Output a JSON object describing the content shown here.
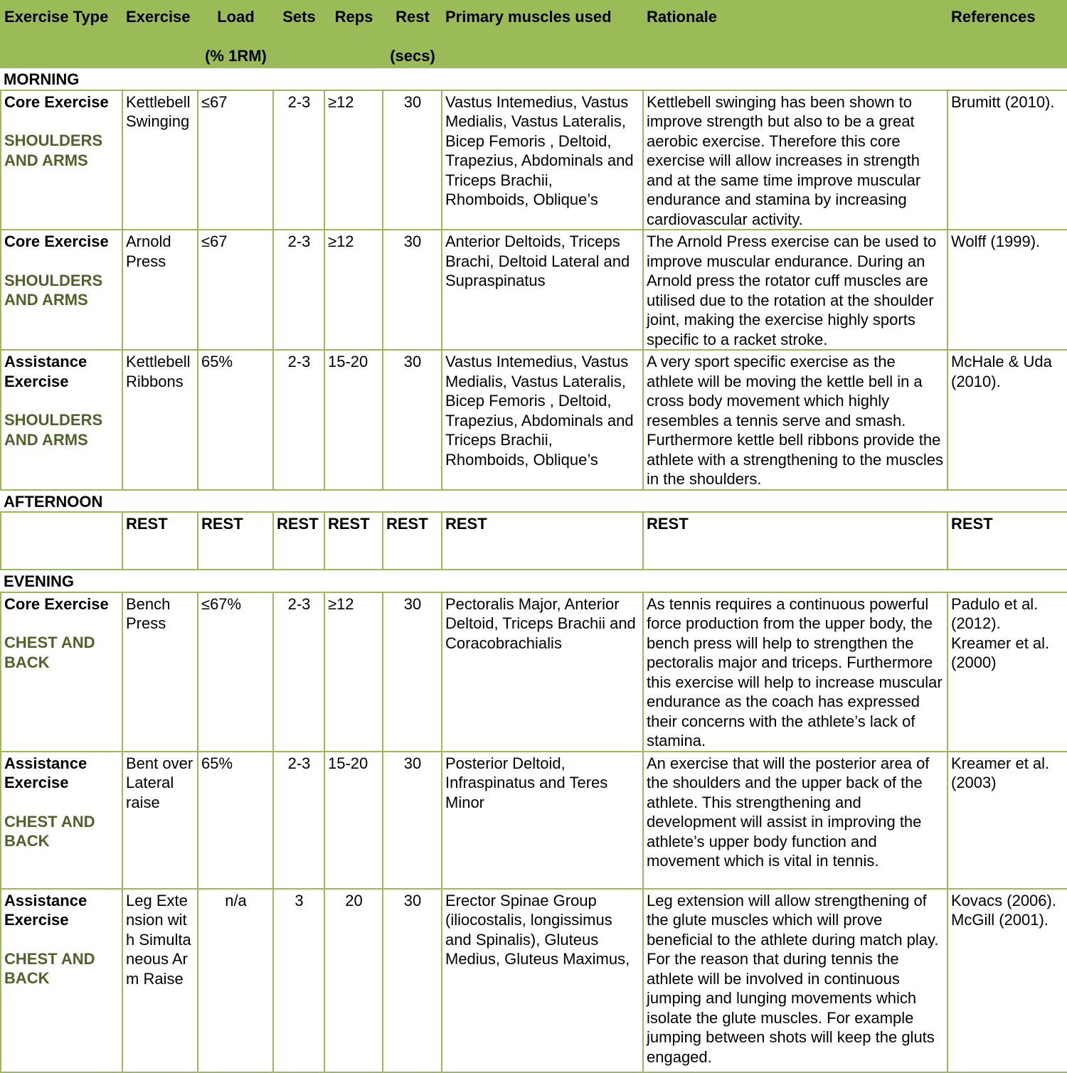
{
  "headers": {
    "exercise_type": "Exercise Type",
    "exercise": "Exercise",
    "load_line1": "Load",
    "load_line2": "(% 1RM)",
    "sets": "Sets",
    "reps": "Reps",
    "rest_line1": "Rest",
    "rest_line2": "(secs)",
    "muscles": "Primary muscles used",
    "rationale": "Rationale",
    "references": "References"
  },
  "morning": {
    "label": "MORNING",
    "rows": [
      {
        "type": "Core Exercise",
        "category": "SHOULDERS AND ARMS",
        "exercise": "Kettlebell Swinging",
        "load": "≤67",
        "sets": "2-3",
        "reps": "≥12",
        "rest": "30",
        "muscles": "Vastus Intemedius, Vastus Medialis, Vastus Lateralis, Bicep Femoris , Deltoid, Trapezius, Abdominals and Triceps Brachii, Rhomboids, Oblique’s",
        "rationale": "Kettlebell swinging has been shown to improve strength but also to be a great aerobic exercise. Therefore this core exercise will allow increases in strength and at the same time improve muscular endurance and stamina by increasing cardiovascular activity.",
        "references": "Brumitt (2010)."
      },
      {
        "type": "Core Exercise",
        "category": "SHOULDERS AND ARMS",
        "exercise": "Arnold Press",
        "load": "≤67",
        "sets": "2-3",
        "reps": "≥12",
        "rest": "30",
        "muscles": "Anterior Deltoids, Triceps Brachi, Deltoid Lateral and Supraspinatus",
        "rationale": "The Arnold Press exercise can be used to improve muscular endurance. During an Arnold press the rotator cuff muscles are utilised due to the rotation at the shoulder joint, making the exercise highly sports specific to a racket stroke.",
        "references": "Wolff (1999)."
      },
      {
        "type": "Assistance Exercise",
        "category": "SHOULDERS AND ARMS",
        "exercise": "Kettlebell Ribbons",
        "load": "65%",
        "sets": "2-3",
        "reps": "15-20",
        "rest": "30",
        "muscles": "Vastus Intemedius, Vastus Medialis, Vastus Lateralis, Bicep Femoris , Deltoid, Trapezius, Abdominals and Triceps Brachii, Rhomboids, Oblique’s",
        "rationale": "A very sport specific exercise as the athlete will be moving the kettle bell in a cross body movement which highly resembles a tennis serve and smash. Furthermore kettle bell ribbons provide the athlete with a strengthening to the muscles in the shoulders.",
        "references": "McHale & Uda (2010)."
      }
    ]
  },
  "afternoon": {
    "label": "AFTERNOON",
    "rest": "REST"
  },
  "evening": {
    "label": "EVENING",
    "rows": [
      {
        "type": "Core Exercise",
        "category": "CHEST AND BACK",
        "exercise": "Bench Press",
        "load": "≤67%",
        "sets": "2-3",
        "reps": "≥12",
        "rest": "30",
        "muscles": "Pectoralis Major, Anterior Deltoid, Triceps Brachii and Coracobrachialis",
        "rationale": "As tennis requires a continuous powerful force production from the upper body, the bench press will help to strengthen the pectoralis major and triceps. Furthermore this exercise will help to increase muscular endurance as the coach has expressed their concerns with the athlete’s lack of stamina.",
        "references": "Padulo et al. (2012). Kreamer et al. (2000)"
      },
      {
        "type": "Assistance Exercise",
        "category": "CHEST AND BACK",
        "exercise": "Bent over Lateral raise",
        "load": "65%",
        "sets": "2-3",
        "reps": "15-20",
        "rest": "30",
        "muscles": "Posterior Deltoid, Infraspinatus and Teres Minor",
        "rationale": "An exercise that will the posterior area of the shoulders and the upper back of the athlete. This strengthening and development will assist in improving the athlete’s upper body function and movement which is vital in tennis.",
        "references": "Kreamer et al. (2003)"
      },
      {
        "type": "Assistance Exercise",
        "category": "CHEST AND BACK",
        "exercise": "Leg Extension with Simultaneous Arm Raise",
        "load": "n/a",
        "sets": "3",
        "reps": "20",
        "rest": "30",
        "muscles": "Erector Spinae Group (iliocostalis, longissimus and Spinalis), Gluteus Medius, Gluteus Maximus,",
        "rationale": "Leg extension will allow strengthening of the glute muscles which will prove beneficial to the athlete during match play. For the reason that during tennis the athlete will be involved in continuous jumping and lunging movements which isolate the glute muscles. For example jumping between shots will keep the gluts engaged.",
        "references": "Kovacs (2006). McGill (2001)."
      }
    ]
  }
}
